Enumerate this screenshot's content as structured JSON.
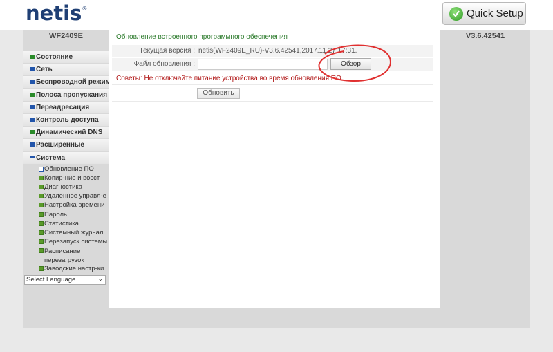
{
  "header": {
    "logo_text": "netis",
    "logo_mark": "®",
    "quick_setup_label": "Quick Setup",
    "quick_setup_icon": "check-circle-icon"
  },
  "device": {
    "model": "WF2409E",
    "version": "V3.6.42541"
  },
  "sidebar": {
    "items": [
      {
        "label": "Состояние"
      },
      {
        "label": "Сеть"
      },
      {
        "label": "Беспроводной режим"
      },
      {
        "label": "Полоса пропускания"
      },
      {
        "label": "Переадресация"
      },
      {
        "label": "Контроль доступа"
      },
      {
        "label": "Динамический DNS"
      },
      {
        "label": "Расширенные"
      },
      {
        "label": "Система"
      }
    ],
    "sub_items": [
      {
        "label": "Обновление ПО"
      },
      {
        "label": "Копир-ние и восст."
      },
      {
        "label": "Диагностика"
      },
      {
        "label": "Удаленное управл-е"
      },
      {
        "label": "Настройка времени"
      },
      {
        "label": "Пароль"
      },
      {
        "label": "Статистика"
      },
      {
        "label": "Системный журнал"
      },
      {
        "label": "Перезапуск системы"
      },
      {
        "label": "Расписание перезагрузок"
      },
      {
        "label": "Заводские настр-ки"
      }
    ],
    "language_select": "Select Language"
  },
  "main": {
    "title": "Обновление встроенного программного обеспечения",
    "current_version_label": "Текущая версия :",
    "current_version_value": "netis(WF2409E_RU)-V3.6.42541,2017.11.27 17:31.",
    "file_label": "Файл обновления :",
    "browse_label": "Обзор",
    "tip": "Советы: Не отключайте питание устройства во время обновления ПО",
    "update_label": "Обновить"
  },
  "colors": {
    "accent_green": "#2b7a2b",
    "tip_red": "#b01515",
    "logo_blue": "#1f3f74",
    "annotation_red": "#e03030"
  }
}
